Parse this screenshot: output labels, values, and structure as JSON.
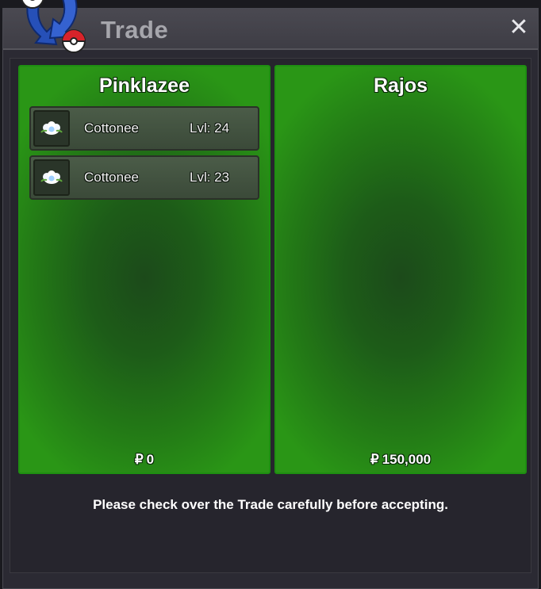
{
  "window": {
    "title": "Trade",
    "close_label": "✕"
  },
  "currency_symbol": "₽",
  "left_panel": {
    "player_name": "Pinklazee",
    "money": "0",
    "pokemon": [
      {
        "name": "Cottonee",
        "level": "Lvl: 24",
        "icon": "cottonee-icon"
      },
      {
        "name": "Cottonee",
        "level": "Lvl: 23",
        "icon": "cottonee-icon"
      }
    ]
  },
  "right_panel": {
    "player_name": "Rajos",
    "money": "150,000",
    "pokemon": []
  },
  "notice": "Please check over the Trade carefully before accepting.",
  "colors": {
    "panel_border": "#1e8f11",
    "panel_fill": "#237a16",
    "window_bg": "#2b2a33"
  }
}
